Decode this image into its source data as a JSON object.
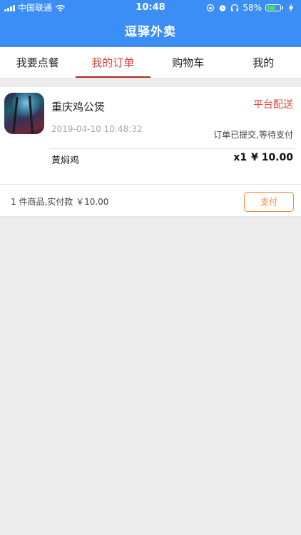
{
  "status_bar": {
    "carrier": "中国联通",
    "time": "10:48",
    "battery_percent": "58%",
    "battery_level": 0.58,
    "icons": [
      "signal-icon",
      "wifi-icon",
      "rotation-lock-icon",
      "alarm-icon",
      "headphones-icon",
      "battery-icon",
      "charging-icon"
    ]
  },
  "header": {
    "title": "逗驿外卖"
  },
  "tabs": [
    {
      "label": "我要点餐",
      "active": false
    },
    {
      "label": "我的订单",
      "active": true
    },
    {
      "label": "购物车",
      "active": false
    },
    {
      "label": "我的",
      "active": false
    }
  ],
  "order": {
    "shop_name": "重庆鸡公煲",
    "delivery_type": "平台配送",
    "time": "2019-04-10 10:48:32",
    "status": "订单已提交,等待支付",
    "items": [
      {
        "name": "黄焖鸡",
        "quantity": "x1",
        "price": "¥ 10.00"
      }
    ],
    "summary": "1 件商品,实付款 ￥10.00",
    "pay_label": "支付"
  },
  "colors": {
    "header_bg": "#3a8ef6",
    "active_tab": "#d83a2e",
    "delivery_text": "#e8463a",
    "pay_button": "#f08a3c",
    "page_bg": "#ececec"
  }
}
